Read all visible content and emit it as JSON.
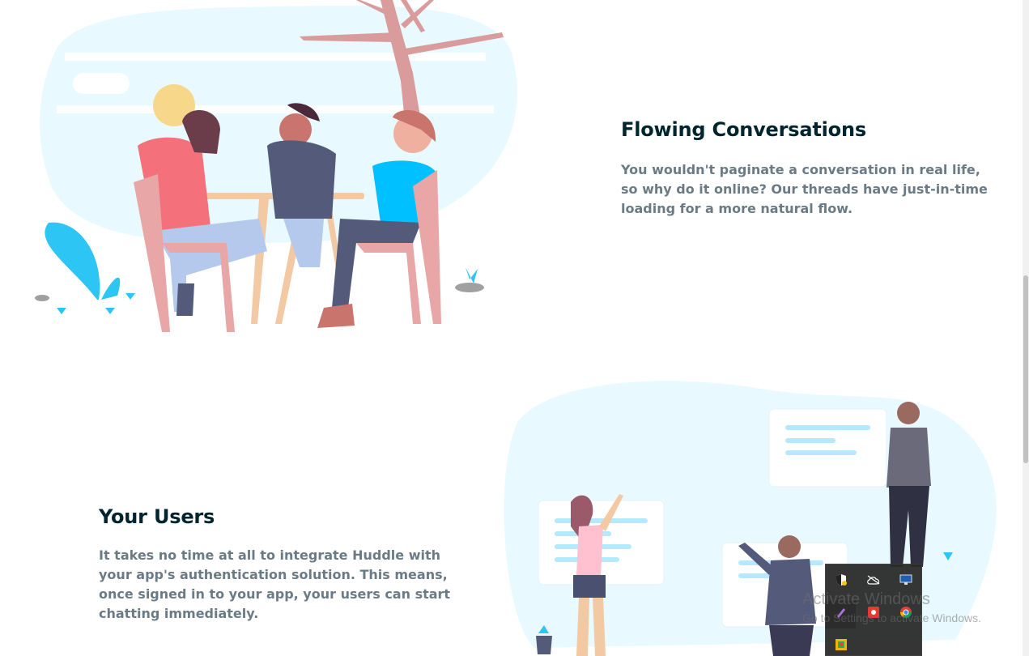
{
  "features": [
    {
      "title": "Flowing Conversations",
      "body": "You wouldn't paginate a conversation in real life, so why do it online? Our threads have just-in-time loading for a more natural flow."
    },
    {
      "title": "Your Users",
      "body": "It takes no time at all to integrate Huddle with your app's authentication solution. This means, once signed in to your app, your users can start chatting immediately."
    }
  ],
  "watermark": {
    "title": "Activate Windows",
    "subtitle": "Go to Settings to activate Windows."
  },
  "tray": {
    "icons": [
      "security-shield-icon",
      "onedrive-cloud-icon",
      "monitor-icon",
      "pen-icon",
      "red-app-icon",
      "chrome-icon",
      "input-method-icon"
    ]
  },
  "colors": {
    "heading": "#00252e",
    "body_text": "#6b7b85",
    "illustration_bg": "#e8faff",
    "accent_cyan": "#00c0ff"
  }
}
